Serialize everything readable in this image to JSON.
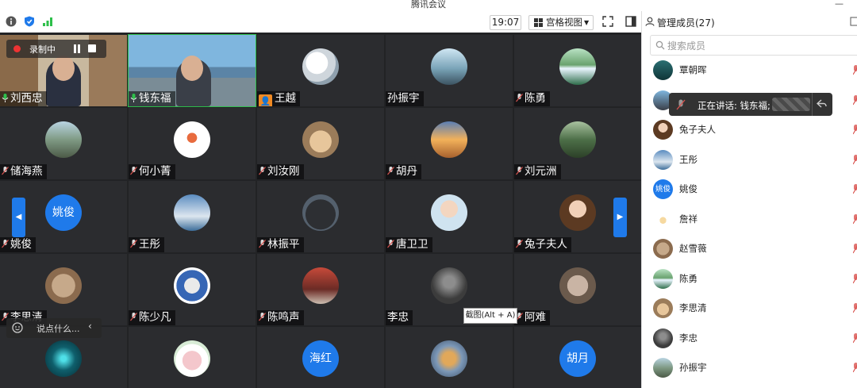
{
  "window": {
    "title": "腾讯会议"
  },
  "toolbar": {
    "time": "19:07",
    "view_label": "宫格视图",
    "icons": [
      "info-icon",
      "shield-icon",
      "signal-icon",
      "grid-icon",
      "fullscreen-icon",
      "sidebar-toggle-icon"
    ]
  },
  "recording": {
    "label": "录制中"
  },
  "grid": {
    "tiles": [
      {
        "name": "刘西忠",
        "type": "video",
        "mic": "green"
      },
      {
        "name": "钱东福",
        "type": "video",
        "mic": "green"
      },
      {
        "name": "王越",
        "type": "avatar",
        "mic": "none",
        "badge": "person-badge"
      },
      {
        "name": "孙振宇",
        "type": "avatar",
        "mic": "none"
      },
      {
        "name": "陈勇",
        "type": "avatar",
        "mic": "muted"
      },
      {
        "name": "储海燕",
        "type": "avatar",
        "mic": "muted"
      },
      {
        "name": "何小菁",
        "type": "avatar",
        "mic": "muted"
      },
      {
        "name": "刘汝刚",
        "type": "avatar",
        "mic": "muted"
      },
      {
        "name": "胡丹",
        "type": "avatar",
        "mic": "muted"
      },
      {
        "name": "刘元洲",
        "type": "avatar",
        "mic": "muted"
      },
      {
        "name": "姚俊",
        "type": "text",
        "avatar_text": "姚俊",
        "mic": "muted"
      },
      {
        "name": "王彤",
        "type": "avatar",
        "mic": "muted"
      },
      {
        "name": "林振平",
        "type": "avatar",
        "mic": "muted"
      },
      {
        "name": "唐卫卫",
        "type": "avatar",
        "mic": "muted"
      },
      {
        "name": "兔子夫人",
        "type": "avatar",
        "mic": "muted"
      },
      {
        "name": "李思清",
        "type": "avatar",
        "mic": "muted"
      },
      {
        "name": "陈少凡",
        "type": "avatar",
        "mic": "muted"
      },
      {
        "name": "陈鸣声",
        "type": "avatar",
        "mic": "muted"
      },
      {
        "name": "李忠",
        "type": "avatar",
        "mic": "none"
      },
      {
        "name": "阿难",
        "type": "avatar",
        "mic": "muted"
      },
      {
        "name": "",
        "type": "avatar",
        "mic": "none"
      },
      {
        "name": "",
        "type": "avatar",
        "mic": "none"
      },
      {
        "name": "",
        "type": "text",
        "avatar_text": "海红",
        "mic": "none"
      },
      {
        "name": "",
        "type": "avatar",
        "mic": "none"
      },
      {
        "name": "",
        "type": "text",
        "avatar_text": "胡月",
        "mic": "none"
      }
    ]
  },
  "chat": {
    "placeholder": "说点什么..."
  },
  "screenshot_tip": "截图(Alt + A)",
  "panel": {
    "title": "管理成员(27)",
    "search_placeholder": "搜索成员",
    "speaking_label": "正在讲话: 钱东福;",
    "members": [
      {
        "name": "覃朝晖"
      },
      {
        "name": "钱东福"
      },
      {
        "name": "兔子夫人"
      },
      {
        "name": "王彤"
      },
      {
        "name": "姚俊",
        "avatar_text": "姚俊"
      },
      {
        "name": "詹祥"
      },
      {
        "name": "赵雪薇"
      },
      {
        "name": "陈勇"
      },
      {
        "name": "李思清"
      },
      {
        "name": "李忠"
      },
      {
        "name": "孙振宇"
      }
    ]
  },
  "colors": {
    "accent": "#1f7aea",
    "grid_bg": "#222325",
    "tile_bg": "#2b2c2f",
    "mic_green": "#2dbf4a",
    "mic_muted": "#d9534f"
  }
}
